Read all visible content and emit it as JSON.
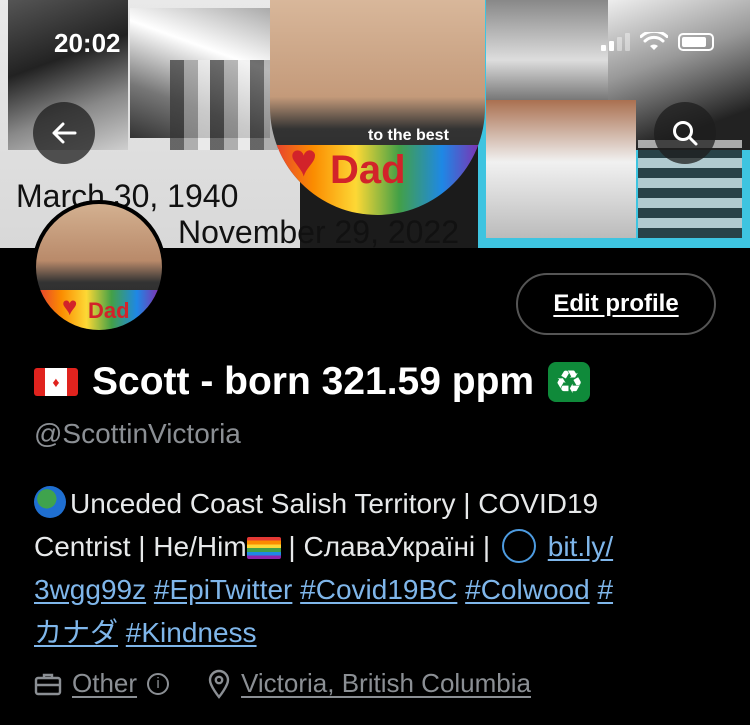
{
  "status_bar": {
    "time": "20:02"
  },
  "banner": {
    "date_born": "March 30, 1940",
    "date_died": "November 29, 2022",
    "tribute_small": "to the best",
    "tribute_big": "Dad"
  },
  "header_actions": {
    "back_icon": "back-arrow-icon",
    "search_icon": "search-icon"
  },
  "profile": {
    "edit_label": "Edit profile",
    "display_name": "Scott - born 321.59 ppm",
    "handle": "@ScottinVictoria",
    "bio": {
      "line1_text": "Unceded Coast Salish Territory | COVID19",
      "line2_text_a": "Centrist | He/Him",
      "line2_text_b": " | СлаваУкраїні | ",
      "link_url_a": "bit.ly/",
      "link_url_b": "3wgg99z",
      "tag_epitwitter": "#EpiTwitter",
      "tag_covid": "#Covid19BC",
      "tag_colwood": "#Colwood",
      "tag_hash": "#",
      "tag_canada": "カナダ",
      "tag_kindness": "#Kindness"
    },
    "category": "Other",
    "location": "Victoria, British Columbia"
  },
  "colors": {
    "background": "#000000",
    "link": "#7fb6ea",
    "muted": "#8b8f94",
    "text": "#e7e9ea"
  }
}
